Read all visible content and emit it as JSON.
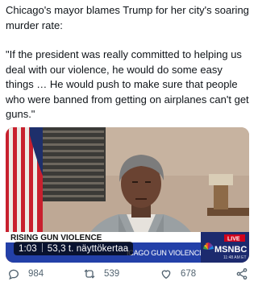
{
  "tweet": {
    "paragraphs": [
      "Chicago's mayor blames Trump for her city's soaring murder rate:",
      "\"If the president was really committed to helping us deal with our violence, he would do some easy things … He would push to make sure that people who were banned from getting on airplanes can't get guns.\""
    ]
  },
  "video": {
    "lower_third_headline": "RISING GUN VIOLENCE",
    "ticker_text": "ICAGO GUN VIOLENCE",
    "live_badge": "LIVE",
    "network_logo": "MSNBC",
    "network_clock": "11:48 AM ET",
    "elapsed_time": "1:03",
    "view_count": "53,3 t. näyttökertaa"
  },
  "actions": {
    "replies": "984",
    "retweets": "539",
    "likes": "678"
  },
  "colors": {
    "text": "#0f1419",
    "muted": "#536471",
    "msnbc_blue": "#1c2a6e",
    "ticker_blue": "#2340a8",
    "live_red": "#d0021b"
  },
  "icons": [
    "reply-icon",
    "retweet-icon",
    "like-icon",
    "share-icon",
    "msnbc-peacock-icon"
  ]
}
